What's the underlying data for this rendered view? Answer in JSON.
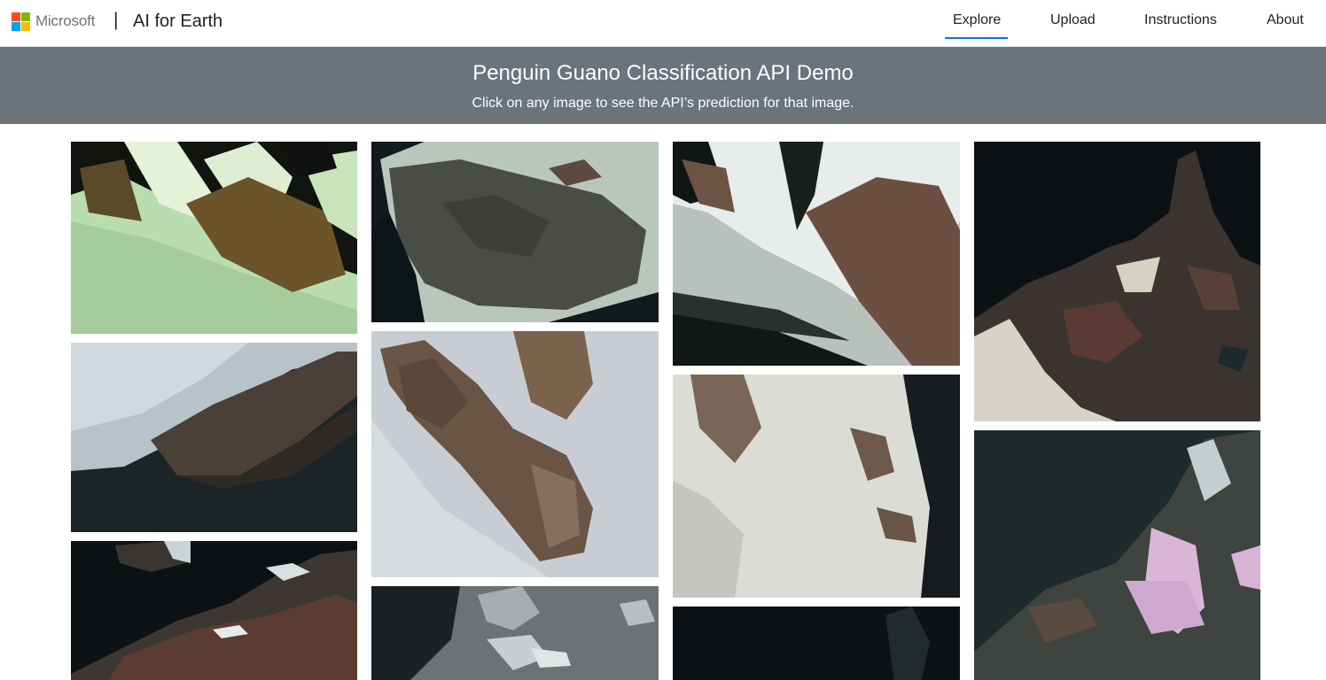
{
  "header": {
    "brand_word": "Microsoft",
    "divider": "|",
    "product_title": "AI for Earth",
    "logo_colors": [
      "#f25022",
      "#7fba00",
      "#00a4ef",
      "#ffb900"
    ]
  },
  "nav": {
    "items": [
      {
        "label": "Explore",
        "active": true
      },
      {
        "label": "Upload",
        "active": false
      },
      {
        "label": "Instructions",
        "active": false
      },
      {
        "label": "About",
        "active": false
      }
    ],
    "accent_color": "#0078d4"
  },
  "banner": {
    "title": "Penguin Guano Classification API Demo",
    "subtitle": "Click on any image to see the API’s prediction for that image.",
    "background": "#6b737b"
  },
  "gallery": {
    "images": [
      {
        "name": "satellite-image-1",
        "palette": "green-ice-brown-rock"
      },
      {
        "name": "satellite-image-2",
        "palette": "dark-rock-snow-sea"
      },
      {
        "name": "satellite-image-3",
        "palette": "snow-brown-rock-sea"
      },
      {
        "name": "satellite-image-4",
        "palette": "dark-sea-brown-island"
      },
      {
        "name": "satellite-image-5",
        "palette": "icy-shore-dark-sea"
      },
      {
        "name": "satellite-image-6",
        "palette": "snow-brown-ridges"
      },
      {
        "name": "satellite-image-7",
        "palette": "snow-slope-rock"
      },
      {
        "name": "satellite-image-8",
        "palette": "sea-pink-guano-island"
      },
      {
        "name": "satellite-image-9",
        "palette": "dark-sea-rock-island"
      },
      {
        "name": "satellite-image-10",
        "palette": "ice-floes-sea"
      },
      {
        "name": "satellite-image-11",
        "palette": "dark-sea"
      }
    ]
  }
}
